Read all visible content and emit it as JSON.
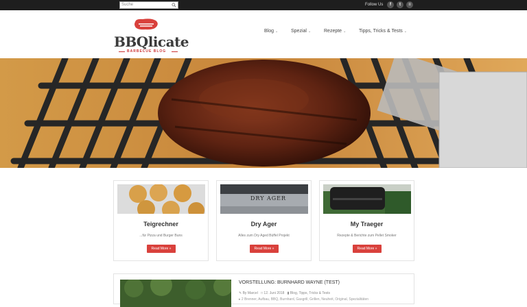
{
  "topbar": {
    "search_placeholder": "Suche",
    "follow_label": "Follow Us",
    "social": [
      {
        "icon": "facebook-icon",
        "glyph": "f"
      },
      {
        "icon": "twitter-icon",
        "glyph": "t"
      },
      {
        "icon": "rss-icon",
        "glyph": "≡"
      }
    ]
  },
  "logo": {
    "title": "BBQlicate",
    "subtitle": "BARBECUE BLOG",
    "accent": "#d9413c"
  },
  "nav": {
    "items": [
      {
        "label": "Blog"
      },
      {
        "label": "Spezial"
      },
      {
        "label": "Rezepte"
      },
      {
        "label": "Tipps, Tricks & Tests"
      }
    ]
  },
  "cards": [
    {
      "title": "Teigrechner",
      "desc": "...für Pizza und Burger Buns",
      "button": "Read More »"
    },
    {
      "title": "Dry Ager",
      "desc": "Alles zum Dry Aged Büffel Projekt",
      "button": "Read More »",
      "img_text": "DRY AGER"
    },
    {
      "title": "My Traeger",
      "desc": "Rezepte & Berichte zum Pellet Smoker",
      "button": "Read More »"
    }
  ],
  "post": {
    "title": "VORSTELLUNG: BURNHARD WAYNE (TEST)",
    "author": "By Marcel",
    "date": "12. Juni 2018",
    "categories": "Blog, Tipps, Tricks & Tests",
    "tags": "2 Brenner, Aufbau, BBQ, Burnhard, Gasgrill, Grillen, Neuheit, Original, Spezialitäten"
  }
}
